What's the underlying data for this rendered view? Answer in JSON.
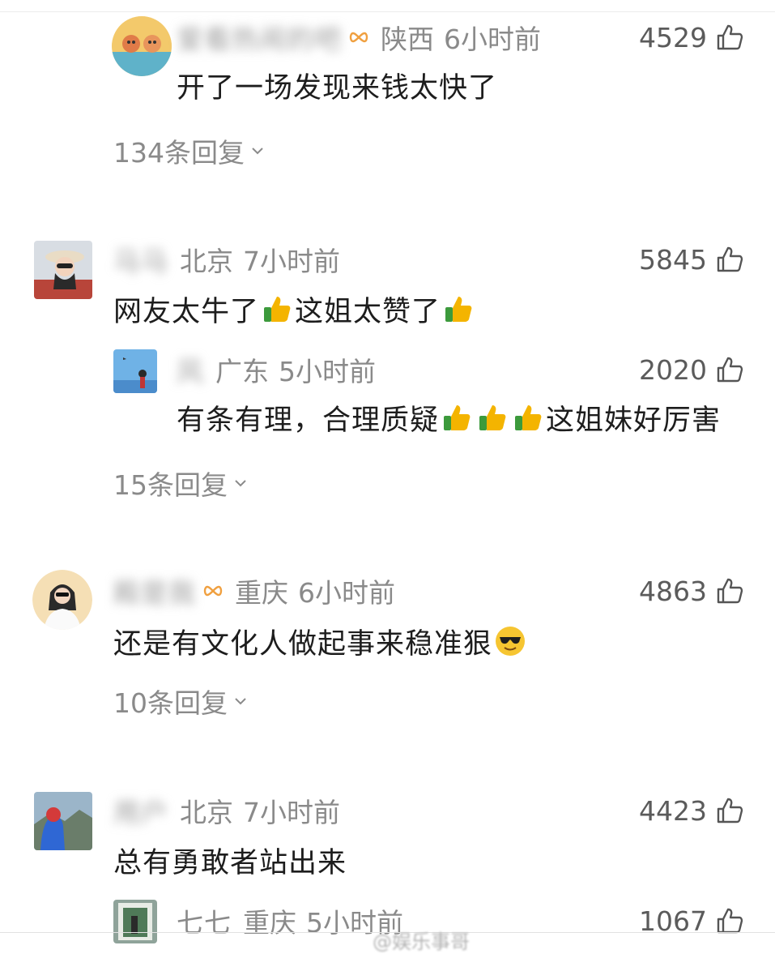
{
  "comments": [
    {
      "username": "爱看热闹的吧",
      "location": "陕西",
      "time": "6小时前",
      "likes": "4529",
      "text": "开了一场发现来钱太快了",
      "replies": "134条回复"
    },
    {
      "username": "马马",
      "location": "北京",
      "time": "7小时前",
      "likes": "5845",
      "text_a": "网友太牛了",
      "text_b": "这姐太赞了",
      "sub_reply": {
        "username": "风",
        "location": "广东",
        "time": "5小时前",
        "likes": "2020",
        "text_a": "有条有理，合理质疑",
        "text_b": "这姐妹好厉害"
      },
      "replies": "15条回复"
    },
    {
      "username": "殿是我",
      "location": "重庆",
      "time": "6小时前",
      "likes": "4863",
      "text": "还是有文化人做起事来稳准狠",
      "replies": "10条回复"
    },
    {
      "username": "用户",
      "location": "北京",
      "time": "7小时前",
      "likes": "4423",
      "text": "总有勇敢者站出来",
      "sub_reply": {
        "username": "七七",
        "location": "重庆",
        "time": "5小时前",
        "likes": "1067"
      }
    }
  ],
  "watermark": "@娱乐事哥",
  "colors": {
    "meta_gray": "#8a8a8a",
    "text": "#1d1d1d",
    "badge_orange": "#f0a040",
    "thumb_green": "#3c9a3c",
    "thumb_yellow": "#f4b400"
  },
  "icons": [
    "thumbs-up-outline-icon",
    "thumbs-up-emoji-icon",
    "sunglasses-emoji-icon",
    "chevron-down-icon",
    "infinity-badge-icon"
  ]
}
